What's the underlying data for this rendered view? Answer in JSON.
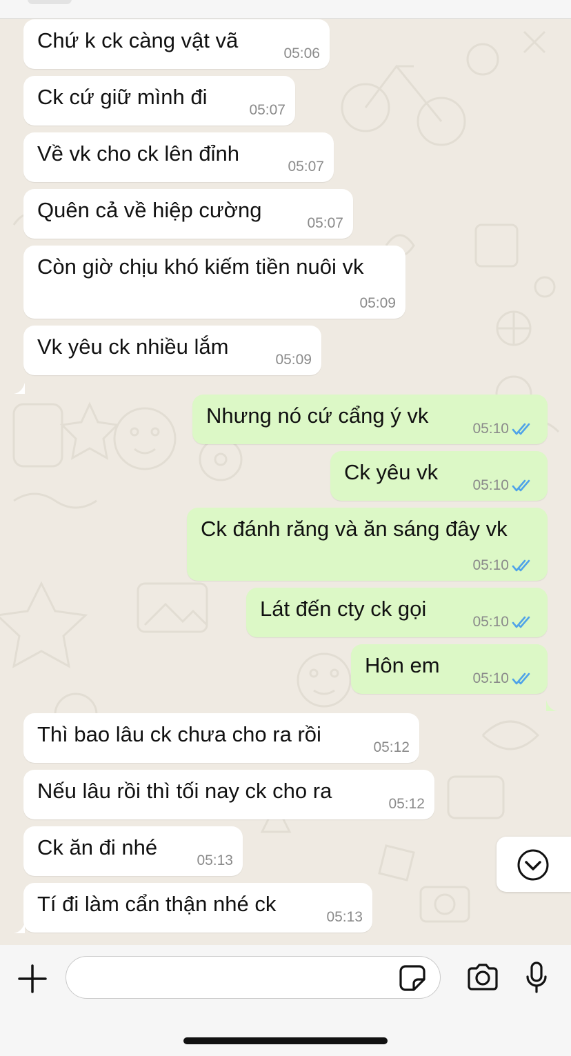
{
  "messages": [
    {
      "dir": "in",
      "text": "Chứ k ck càng vật vã",
      "time": "05:06"
    },
    {
      "dir": "in",
      "text": "Ck cứ giữ mình đi",
      "time": "05:07"
    },
    {
      "dir": "in",
      "text": "Về vk cho ck lên đỉnh",
      "time": "05:07"
    },
    {
      "dir": "in",
      "text": "Quên cả về hiệp cường",
      "time": "05:07"
    },
    {
      "dir": "in",
      "text": "Còn giờ chịu khó kiếm tiền nuôi vk",
      "time": "05:09"
    },
    {
      "dir": "in",
      "text": "Vk yêu ck nhiều lắm",
      "time": "05:09"
    },
    {
      "dir": "out",
      "text": "Nhưng nó cứ cẩng ý vk",
      "time": "05:10",
      "status": "read"
    },
    {
      "dir": "out",
      "text": "Ck yêu vk",
      "time": "05:10",
      "status": "read"
    },
    {
      "dir": "out",
      "text": "Ck đánh răng và ăn sáng đây vk",
      "time": "05:10",
      "status": "read"
    },
    {
      "dir": "out",
      "text": "Lát đến cty ck gọi",
      "time": "05:10",
      "status": "read"
    },
    {
      "dir": "out",
      "text": "Hôn em",
      "time": "05:10",
      "status": "read"
    },
    {
      "dir": "in",
      "text": "Thì bao lâu ck chưa cho ra rồi",
      "time": "05:12"
    },
    {
      "dir": "in",
      "text": "Nếu lâu rồi thì tối nay ck cho ra",
      "time": "05:12"
    },
    {
      "dir": "in",
      "text": "Ck ăn đi nhé",
      "time": "05:13"
    },
    {
      "dir": "in",
      "text": "Tí đi làm cẩn thận nhé ck",
      "time": "05:13"
    }
  ],
  "composer": {
    "value": "",
    "icons": [
      "plus-icon",
      "sticker-icon",
      "camera-icon",
      "microphone-icon"
    ]
  },
  "scroll_button_icon": "chevron-down-icon",
  "colors": {
    "background": "#efeae2",
    "incoming_bubble": "#ffffff",
    "outgoing_bubble": "#dcf8c6",
    "read_ticks": "#4fa3e8",
    "timestamp": "#8a8a8a"
  }
}
